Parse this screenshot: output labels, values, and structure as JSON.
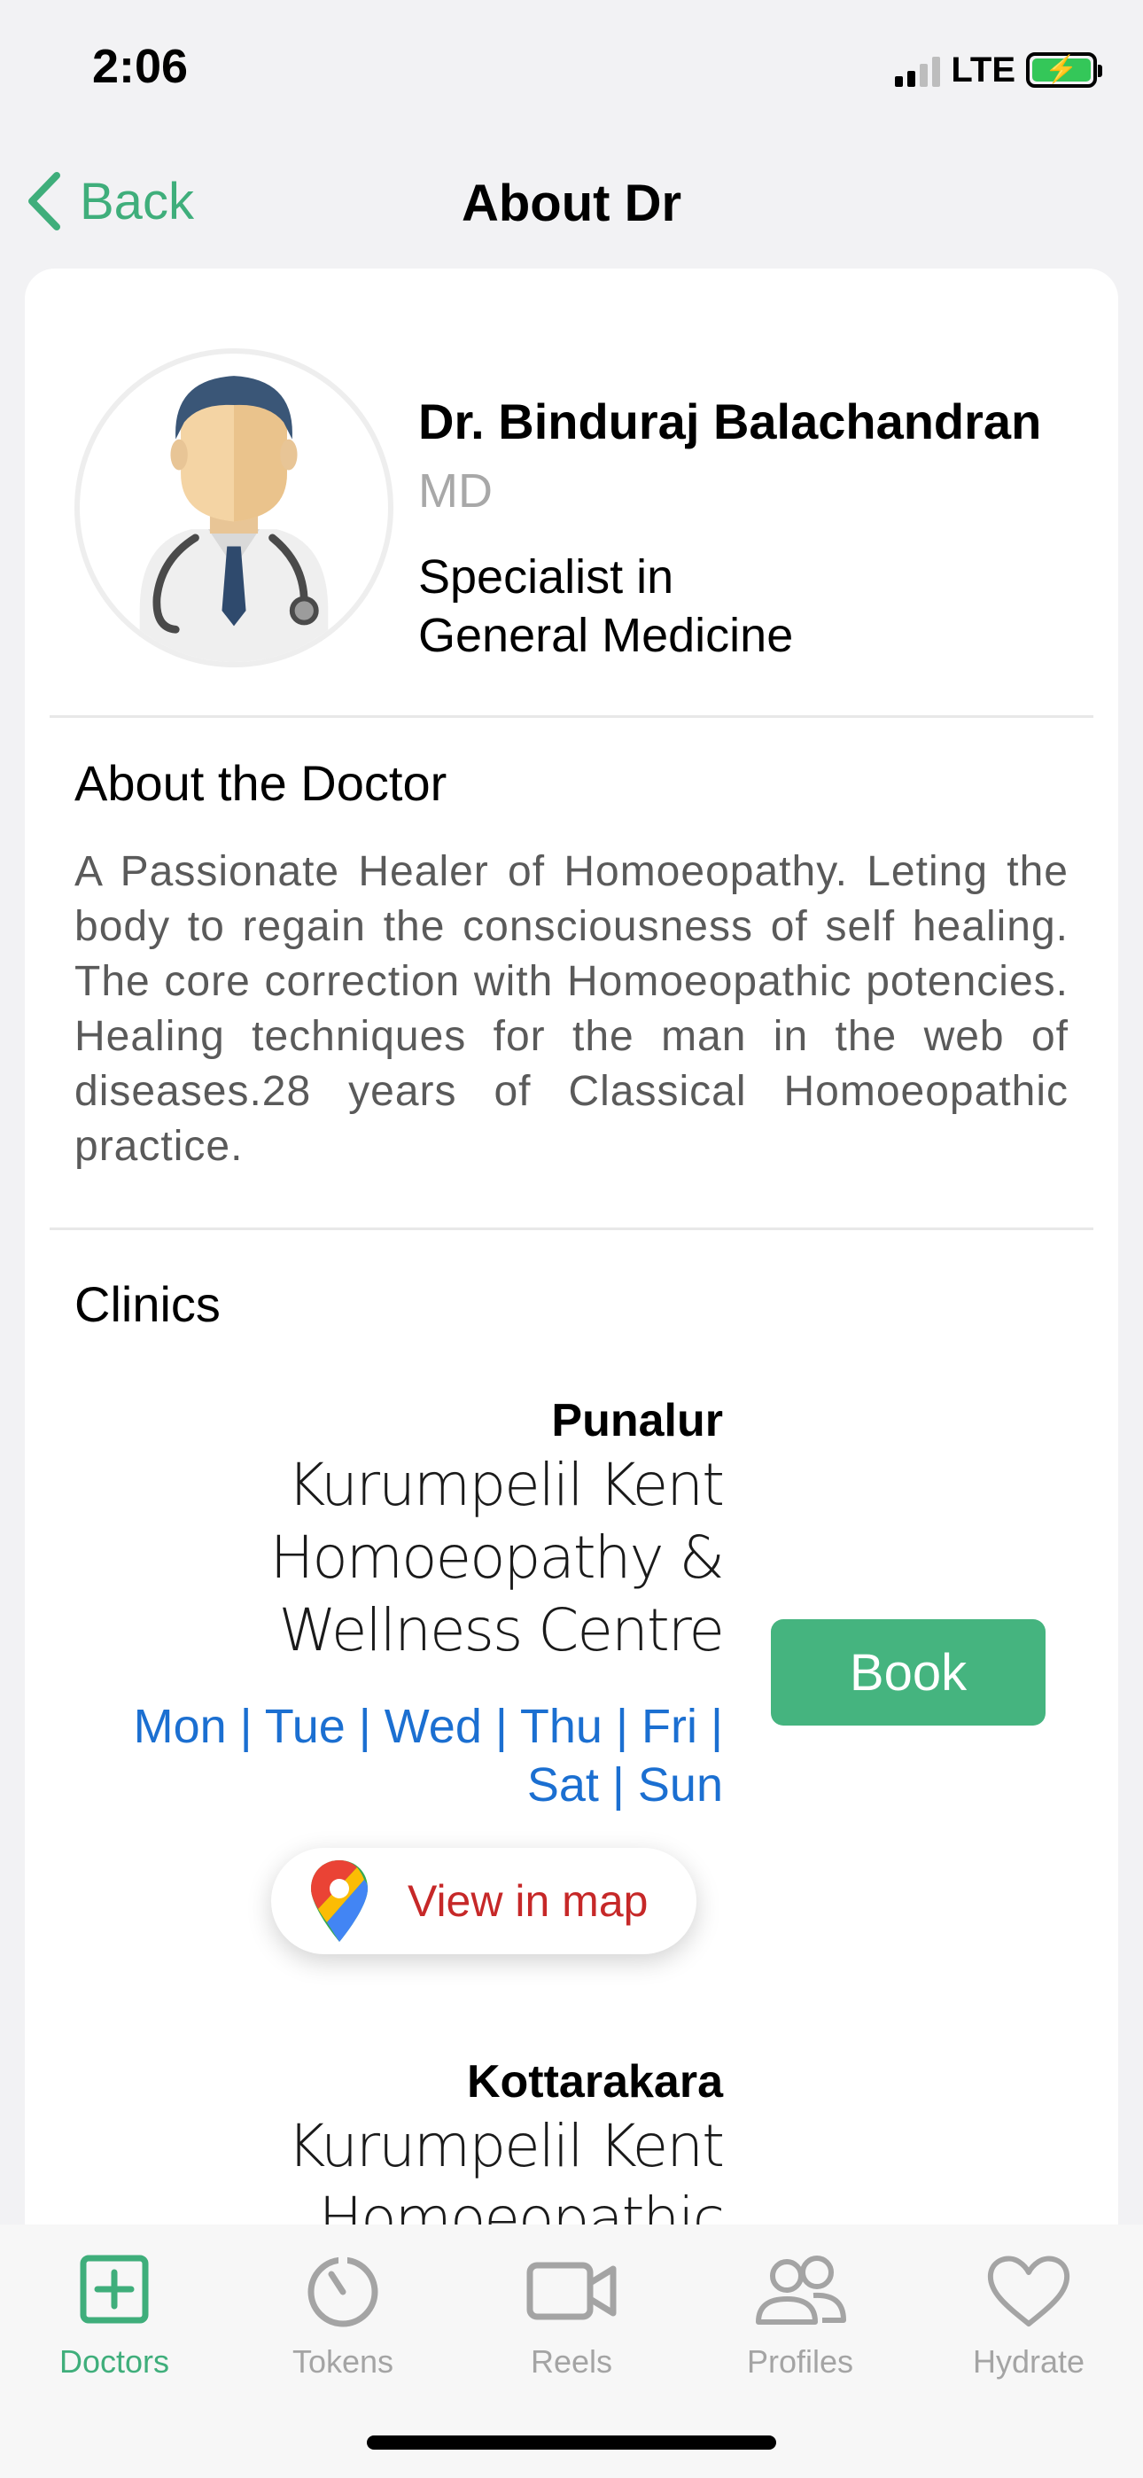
{
  "status_bar": {
    "time": "2:06",
    "network": "LTE"
  },
  "nav": {
    "back_label": "Back",
    "title": "About Dr"
  },
  "doctor": {
    "name": "Dr. Binduraj Balachandran",
    "degree": "MD",
    "specialty_line1": "Specialist in",
    "specialty_line2": "General Medicine"
  },
  "about": {
    "title": "About the Doctor",
    "text": "A Passionate Healer of Homoeopathy. Leting the body to regain the consciousness of self healing. The core correction with Homoeopathic potencies. Healing techniques for the man in the web of diseases.28 years of Classical Homoeopathic practice."
  },
  "clinics": {
    "title": "Clinics",
    "items": [
      {
        "place": "Punalur",
        "name": "Kurumpelil Kent Homoeopathy & Wellness Centre",
        "days": "Mon | Tue | Wed | Thu | Fri | Sat | Sun",
        "book_label": "Book",
        "map_label": "View in map"
      },
      {
        "place": "Kottarakara",
        "name": "Kurumpelil Kent Homoeopathic"
      }
    ]
  },
  "tabs": [
    {
      "label": "Doctors",
      "icon": "plus-square-icon",
      "active": true
    },
    {
      "label": "Tokens",
      "icon": "timer-icon",
      "active": false
    },
    {
      "label": "Reels",
      "icon": "video-camera-icon",
      "active": false
    },
    {
      "label": "Profiles",
      "icon": "people-icon",
      "active": false
    },
    {
      "label": "Hydrate",
      "icon": "heart-icon",
      "active": false
    }
  ],
  "colors": {
    "accent": "#3fae7b",
    "book_button": "#45b47f",
    "days_link": "#1b6fd1",
    "map_label": "#c62828",
    "inactive_tab": "#a4a4a4"
  }
}
